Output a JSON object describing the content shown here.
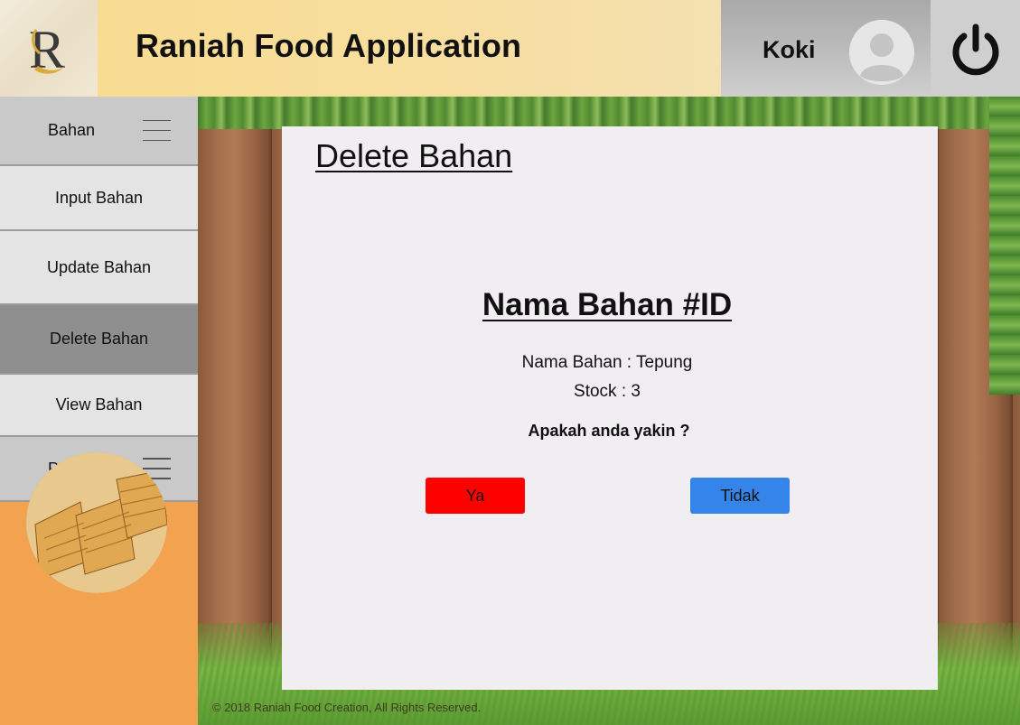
{
  "header": {
    "app_title": "Raniah Food Application",
    "user_name": "Koki",
    "logo_letter": "R",
    "icons": {
      "logo": "raniah-logo-icon",
      "avatar": "user-avatar-icon",
      "power": "power-icon"
    }
  },
  "sidebar": {
    "items": [
      {
        "label": "Bahan",
        "type": "category",
        "icon": "hamburger-menu-icon"
      },
      {
        "label": "Input Bahan",
        "type": "sub"
      },
      {
        "label": "Update Bahan",
        "type": "sub"
      },
      {
        "label": "Delete Bahan",
        "type": "sub",
        "active": true
      },
      {
        "label": "View Bahan",
        "type": "sub"
      },
      {
        "label": "Produk",
        "type": "category",
        "icon": "hamburger-menu-icon"
      }
    ],
    "image": "layered-cake-photo"
  },
  "main": {
    "page_title": "Delete Bahan",
    "item_heading": "Nama Bahan #ID",
    "name_line": "Nama Bahan : Tepung",
    "stock_line": "Stock : 3",
    "confirm_question": "Apakah anda yakin ?",
    "yes_label": "Ya",
    "no_label": "Tidak"
  },
  "footer": {
    "text": "© 2018 Raniah Food Creation, All Rights Reserved."
  },
  "colors": {
    "header_yellow": "#f8dc92",
    "sidebar_orange": "#f3a24f",
    "active_item": "#8f8f8f",
    "yes_button": "#ff0000",
    "no_button": "#3584ea",
    "panel": "#f0eef0"
  }
}
